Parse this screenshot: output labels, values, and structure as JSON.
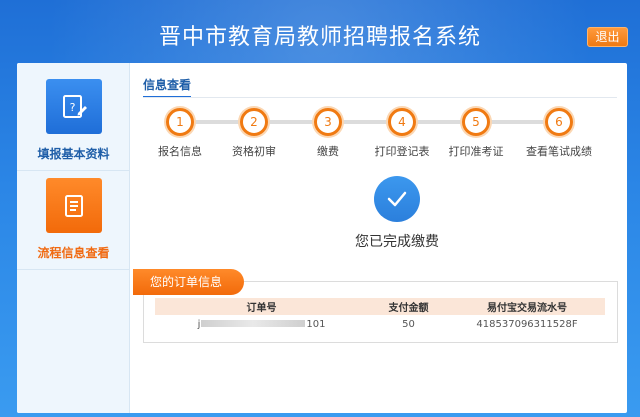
{
  "header": {
    "title": "晋中市教育局教师招聘报名系统",
    "logout_label": "退出"
  },
  "sidebar": {
    "items": [
      {
        "label": "填报基本资料",
        "icon": "edit-form-icon",
        "color": "#2a7de2"
      },
      {
        "label": "流程信息查看",
        "icon": "document-list-icon",
        "color": "#f26a0a"
      }
    ]
  },
  "main": {
    "tab_title": "信息查看",
    "steps": [
      {
        "num": "1",
        "label": "报名信息"
      },
      {
        "num": "2",
        "label": "资格初审"
      },
      {
        "num": "3",
        "label": "缴费"
      },
      {
        "num": "4",
        "label": "打印登记表"
      },
      {
        "num": "5",
        "label": "打印准考证"
      },
      {
        "num": "6",
        "label": "查看笔试成绩"
      }
    ],
    "status_text": "您已完成缴费",
    "order": {
      "tab_label": "您的订单信息",
      "columns": [
        "订单号",
        "支付金额",
        "易付宝交易流水号"
      ],
      "rows": [
        {
          "order_prefix": "j",
          "order_suffix": "101",
          "amount": "50",
          "serial": "418537096311528F"
        }
      ]
    }
  },
  "colors": {
    "accent_orange": "#f07a12",
    "accent_blue": "#1f6ed8"
  }
}
